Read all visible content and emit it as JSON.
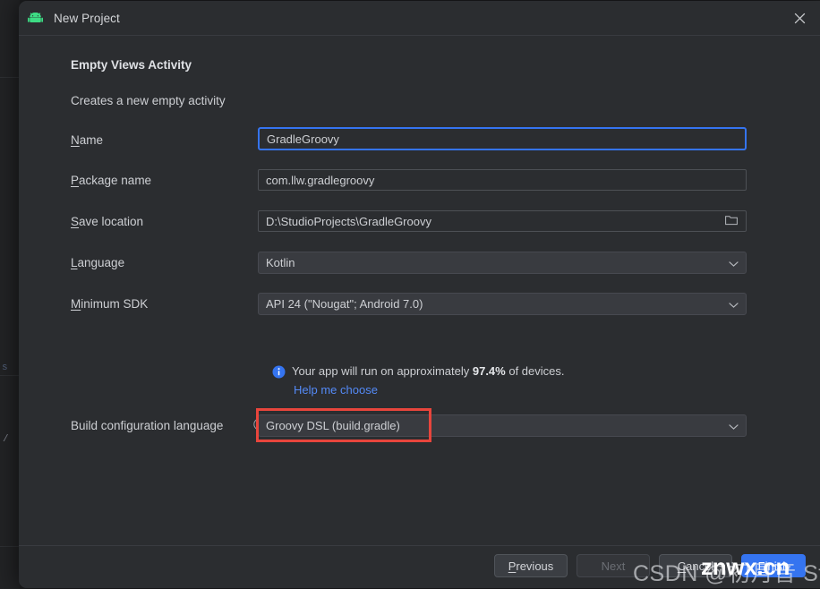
{
  "window": {
    "title": "New Project",
    "app_icon": "android-robot-icon",
    "close_icon": "close-icon"
  },
  "content": {
    "heading": "Empty Views Activity",
    "subheading": "Creates a new empty activity",
    "fields": [
      {
        "label_prefix": "",
        "mnemonic": "N",
        "label_suffix": "ame",
        "value": "GradleGroovy",
        "type": "text",
        "focused": true,
        "name": "name"
      },
      {
        "label_prefix": "",
        "mnemonic": "P",
        "label_suffix": "ackage name",
        "value": "com.llw.gradlegroovy",
        "type": "text",
        "focused": false,
        "name": "package-name"
      },
      {
        "label_prefix": "",
        "mnemonic": "S",
        "label_suffix": "ave location",
        "value": "D:\\StudioProjects\\GradleGroovy",
        "type": "text-with-browse",
        "focused": false,
        "name": "save-location",
        "trailing_icon": "folder-icon"
      },
      {
        "label_prefix": "",
        "mnemonic": "L",
        "label_suffix": "anguage",
        "value": "Kotlin",
        "type": "combo",
        "name": "language",
        "trailing_icon": "chevron-down-icon"
      },
      {
        "label_prefix": "",
        "mnemonic": "M",
        "label_suffix": "inimum SDK",
        "value": "API 24 (\"Nougat\"; Android 7.0)",
        "type": "combo",
        "name": "minimum-sdk",
        "trailing_icon": "chevron-down-icon"
      },
      {
        "label_prefix": "Build configuration language",
        "mnemonic": "",
        "label_suffix": "",
        "value": "Groovy DSL (build.gradle)",
        "type": "combo",
        "name": "build-configuration-language",
        "trailing_icon": "chevron-down-icon",
        "help_icon": "help-circle-icon",
        "highlighted": true
      }
    ],
    "info": {
      "icon": "info-icon",
      "icon_color": "#3574f0",
      "text_before": "Your app will run on approximately ",
      "percent": "97.4%",
      "text_after": " of devices.",
      "link": "Help me choose",
      "link_color": "#548af7"
    },
    "annotation": {
      "shape": "rectangle",
      "color": "#e8453c"
    }
  },
  "footer": {
    "buttons": [
      {
        "label_prefix": "",
        "mnemonic": "P",
        "label_suffix": "revious",
        "state": "enabled",
        "style": "default",
        "name": "previous-button"
      },
      {
        "label_prefix": "",
        "mnemonic": "N",
        "label_suffix": "ext",
        "state": "disabled",
        "style": "default",
        "name": "next-button"
      },
      {
        "label_prefix": "",
        "mnemonic": "C",
        "label_suffix": "ancel",
        "state": "enabled",
        "style": "default",
        "name": "cancel-button"
      },
      {
        "label_prefix": "",
        "mnemonic": "F",
        "label_suffix": "inish",
        "state": "enabled",
        "style": "primary",
        "name": "finish-button"
      }
    ]
  },
  "watermark": {
    "light_text": "CSDN @初月音 Study",
    "bold_text": "znwx.cn"
  }
}
